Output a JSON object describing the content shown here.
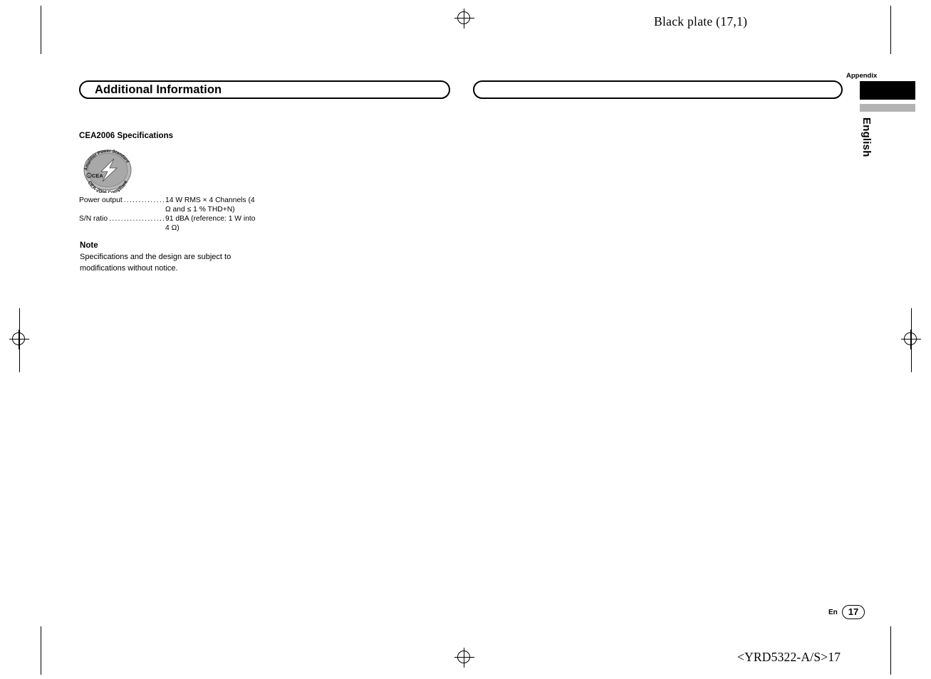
{
  "page": {
    "black_plate": "Black plate (17,1)",
    "doc_code": "<YRD5322-A/S>17",
    "page_number": "17",
    "page_lang": "En"
  },
  "sections": {
    "left_title": "Additional Information",
    "right_title": ""
  },
  "tabs": {
    "appendix": "Appendix",
    "language": "English"
  },
  "content": {
    "cea_heading": "CEA2006 Specifications",
    "specs": [
      {
        "label": "Power output",
        "dots": "....................",
        "value": "14 W RMS × 4 Channels (4 Ω and ≤ 1 % THD+N)"
      },
      {
        "label": "S/N ratio",
        "dots": ".........................",
        "value": "91 dBA (reference: 1 W into 4 Ω)"
      }
    ],
    "note_heading": "Note",
    "note_text": "Specifications and the design are subject to modifications without notice."
  },
  "logo": {
    "top_arc_text": "Amplifier Power Standard",
    "bottom_arc_text": "CEA-2006 Compliant",
    "mark_text": "CEA"
  }
}
